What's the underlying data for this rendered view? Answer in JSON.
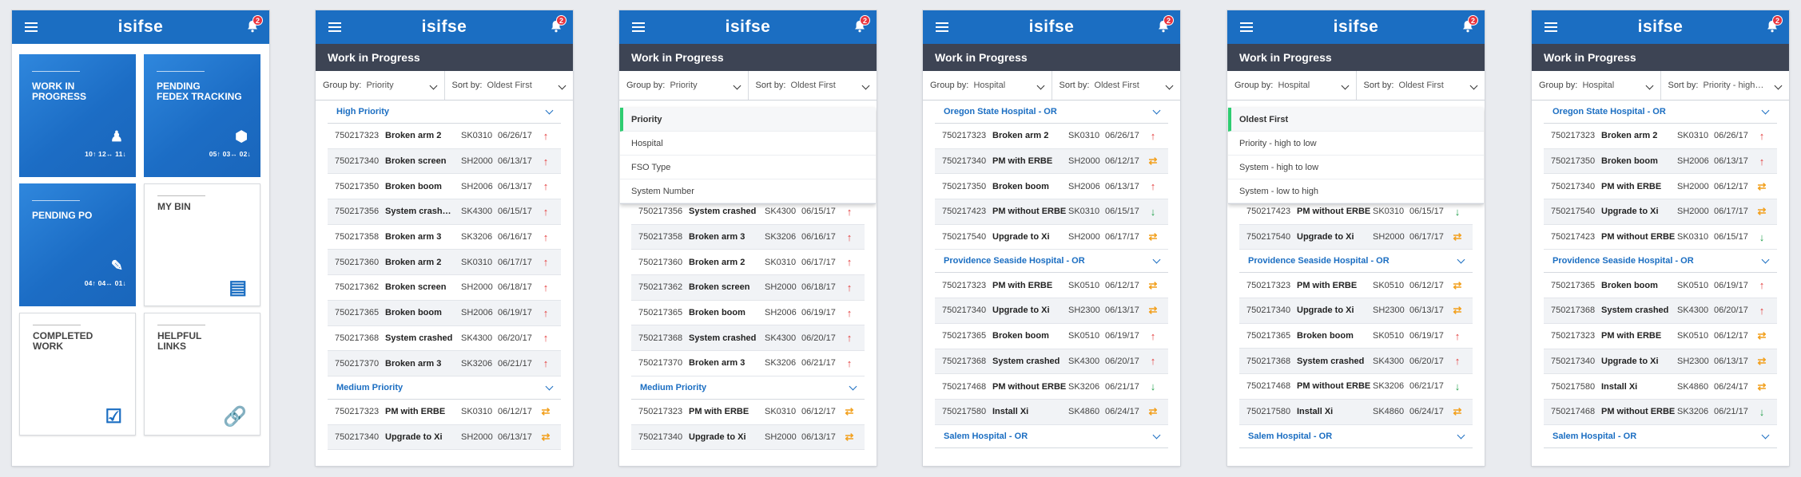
{
  "app": {
    "logo": "isifse",
    "badge": "2"
  },
  "home": {
    "tiles": [
      {
        "label": "WORK IN\nPROGRESS",
        "icon": "technician-icon",
        "count": "10↑ 12↔ 11↓"
      },
      {
        "label": "PENDING\nFEDEX TRACKING",
        "icon": "package-icon",
        "count": "05↑ 03↔ 02↓"
      },
      {
        "label": "PENDING PO",
        "icon": "pen-icon",
        "count": "04↑ 04↔ 01↓"
      },
      {
        "label": "MY BIN",
        "icon": "archive-icon",
        "count": ""
      },
      {
        "label": "COMPLETED\nWORK",
        "icon": "clipboard-check-icon",
        "count": ""
      },
      {
        "label": "HELPFUL\nLINKS",
        "icon": "link-icon",
        "count": ""
      }
    ]
  },
  "wip_title": "Work in Progress",
  "screens": [
    {
      "group_label": "Group by:",
      "group": "Priority",
      "sort_label": "Sort by:",
      "sort": "Oldest First",
      "groups": [
        {
          "title": "High Priority",
          "rows": [
            [
              "750217323",
              "Broken arm 2",
              "SK0310",
              "06/26/17",
              "up"
            ],
            [
              "750217340",
              "Broken screen",
              "SH2000",
              "06/13/17",
              "up"
            ],
            [
              "750217350",
              "Broken boom",
              "SH2006",
              "06/13/17",
              "up"
            ],
            [
              "750217356",
              "System crash…",
              "SK4300",
              "06/15/17",
              "up"
            ],
            [
              "750217358",
              "Broken arm 3",
              "SK3206",
              "06/16/17",
              "up"
            ],
            [
              "750217360",
              "Broken arm 2",
              "SK0310",
              "06/17/17",
              "up"
            ],
            [
              "750217362",
              "Broken screen",
              "SH2000",
              "06/18/17",
              "up"
            ],
            [
              "750217365",
              "Broken boom",
              "SH2006",
              "06/19/17",
              "up"
            ],
            [
              "750217368",
              "System crashed",
              "SK4300",
              "06/20/17",
              "up"
            ],
            [
              "750217370",
              "Broken arm 3",
              "SK3206",
              "06/21/17",
              "up"
            ]
          ]
        },
        {
          "title": "Medium Priority",
          "rows": [
            [
              "750217323",
              "PM with ERBE",
              "SK0310",
              "06/12/17",
              "side"
            ],
            [
              "750217340",
              "Upgrade to Xi",
              "SH2000",
              "06/13/17",
              "side"
            ]
          ]
        }
      ]
    },
    {
      "group_label": "Group by:",
      "group": "Priority",
      "sort_label": "Sort by:",
      "sort": "Oldest First",
      "dropdown": [
        "Priority",
        "Hospital",
        "FSO Type",
        "System Number"
      ],
      "groups": [
        {
          "title": "",
          "rows": [
            [
              "750217356",
              "System crashed",
              "SK4300",
              "06/15/17",
              "up"
            ],
            [
              "750217358",
              "Broken arm 3",
              "SK3206",
              "06/16/17",
              "up"
            ],
            [
              "750217360",
              "Broken arm 2",
              "SK0310",
              "06/17/17",
              "up"
            ],
            [
              "750217362",
              "Broken screen",
              "SH2000",
              "06/18/17",
              "up"
            ],
            [
              "750217365",
              "Broken boom",
              "SH2006",
              "06/19/17",
              "up"
            ],
            [
              "750217368",
              "System crashed",
              "SK4300",
              "06/20/17",
              "up"
            ],
            [
              "750217370",
              "Broken arm 3",
              "SK3206",
              "06/21/17",
              "up"
            ]
          ]
        },
        {
          "title": "Medium Priority",
          "rows": [
            [
              "750217323",
              "PM with ERBE",
              "SK0310",
              "06/12/17",
              "side"
            ],
            [
              "750217340",
              "Upgrade to Xi",
              "SH2000",
              "06/13/17",
              "side"
            ]
          ]
        }
      ]
    },
    {
      "group_label": "Group by:",
      "group": "Hospital",
      "sort_label": "Sort by:",
      "sort": "Oldest First",
      "groups": [
        {
          "title": "Oregon State Hospital - OR",
          "rows": [
            [
              "750217323",
              "Broken arm 2",
              "SK0310",
              "06/26/17",
              "up"
            ],
            [
              "750217340",
              "PM with ERBE",
              "SH2000",
              "06/12/17",
              "side"
            ],
            [
              "750217350",
              "Broken boom",
              "SH2006",
              "06/13/17",
              "up"
            ],
            [
              "750217423",
              "PM without ERBE",
              "SK0310",
              "06/15/17",
              "down"
            ],
            [
              "750217540",
              "Upgrade to Xi",
              "SH2000",
              "06/17/17",
              "side"
            ]
          ]
        },
        {
          "title": "Providence Seaside Hospital - OR",
          "rows": [
            [
              "750217323",
              "PM with ERBE",
              "SK0510",
              "06/12/17",
              "side"
            ],
            [
              "750217340",
              "Upgrade to Xi",
              "SH2300",
              "06/13/17",
              "side"
            ],
            [
              "750217365",
              "Broken boom",
              "SK0510",
              "06/19/17",
              "up"
            ],
            [
              "750217368",
              "System crashed",
              "SK4300",
              "06/20/17",
              "up"
            ],
            [
              "750217468",
              "PM without ERBE",
              "SK3206",
              "06/21/17",
              "down"
            ],
            [
              "750217580",
              "Install Xi",
              "SK4860",
              "06/24/17",
              "side"
            ]
          ]
        },
        {
          "title": "Salem Hospital - OR",
          "rows": []
        }
      ]
    },
    {
      "group_label": "Group by:",
      "group": "Hospital",
      "sort_label": "Sort by:",
      "sort": "Oldest First",
      "dropdown": [
        "Oldest First",
        "Priority - high to low",
        "System - high to low",
        "System - low to high"
      ],
      "groups": [
        {
          "title": "",
          "rows": [
            [
              "750217423",
              "PM without ERBE",
              "SK0310",
              "06/15/17",
              "down"
            ],
            [
              "750217540",
              "Upgrade to Xi",
              "SH2000",
              "06/17/17",
              "side"
            ]
          ]
        },
        {
          "title": "Providence Seaside Hospital - OR",
          "rows": [
            [
              "750217323",
              "PM with ERBE",
              "SK0510",
              "06/12/17",
              "side"
            ],
            [
              "750217340",
              "Upgrade to Xi",
              "SH2300",
              "06/13/17",
              "side"
            ],
            [
              "750217365",
              "Broken boom",
              "SK0510",
              "06/19/17",
              "up"
            ],
            [
              "750217368",
              "System crashed",
              "SK4300",
              "06/20/17",
              "up"
            ],
            [
              "750217468",
              "PM without ERBE",
              "SK3206",
              "06/21/17",
              "down"
            ],
            [
              "750217580",
              "Install Xi",
              "SK4860",
              "06/24/17",
              "side"
            ]
          ]
        },
        {
          "title": "Salem Hospital - OR",
          "rows": []
        }
      ]
    },
    {
      "group_label": "Group by:",
      "group": "Hospital",
      "sort_label": "Sort by:",
      "sort": "Priority - high…",
      "groups": [
        {
          "title": "Oregon State Hospital - OR",
          "rows": [
            [
              "750217323",
              "Broken arm 2",
              "SK0310",
              "06/26/17",
              "up"
            ],
            [
              "750217350",
              "Broken boom",
              "SH2006",
              "06/13/17",
              "up"
            ],
            [
              "750217340",
              "PM with ERBE",
              "SH2000",
              "06/12/17",
              "side"
            ],
            [
              "750217540",
              "Upgrade to Xi",
              "SH2000",
              "06/17/17",
              "side"
            ],
            [
              "750217423",
              "PM without ERBE",
              "SK0310",
              "06/15/17",
              "down"
            ]
          ]
        },
        {
          "title": "Providence Seaside Hospital - OR",
          "rows": [
            [
              "750217365",
              "Broken boom",
              "SK0510",
              "06/19/17",
              "up"
            ],
            [
              "750217368",
              "System crashed",
              "SK4300",
              "06/20/17",
              "up"
            ],
            [
              "750217323",
              "PM with ERBE",
              "SK0510",
              "06/12/17",
              "side"
            ],
            [
              "750217340",
              "Upgrade to Xi",
              "SH2300",
              "06/13/17",
              "side"
            ],
            [
              "750217580",
              "Install Xi",
              "SK4860",
              "06/24/17",
              "side"
            ],
            [
              "750217468",
              "PM without ERBE",
              "SK3206",
              "06/21/17",
              "down"
            ]
          ]
        },
        {
          "title": "Salem Hospital - OR",
          "rows": []
        }
      ]
    }
  ],
  "colors": {
    "brand": "#1b6ec2",
    "titlebar": "#3d4454",
    "up": "#e33b3b",
    "down": "#22a04b",
    "side": "#f2a120"
  }
}
